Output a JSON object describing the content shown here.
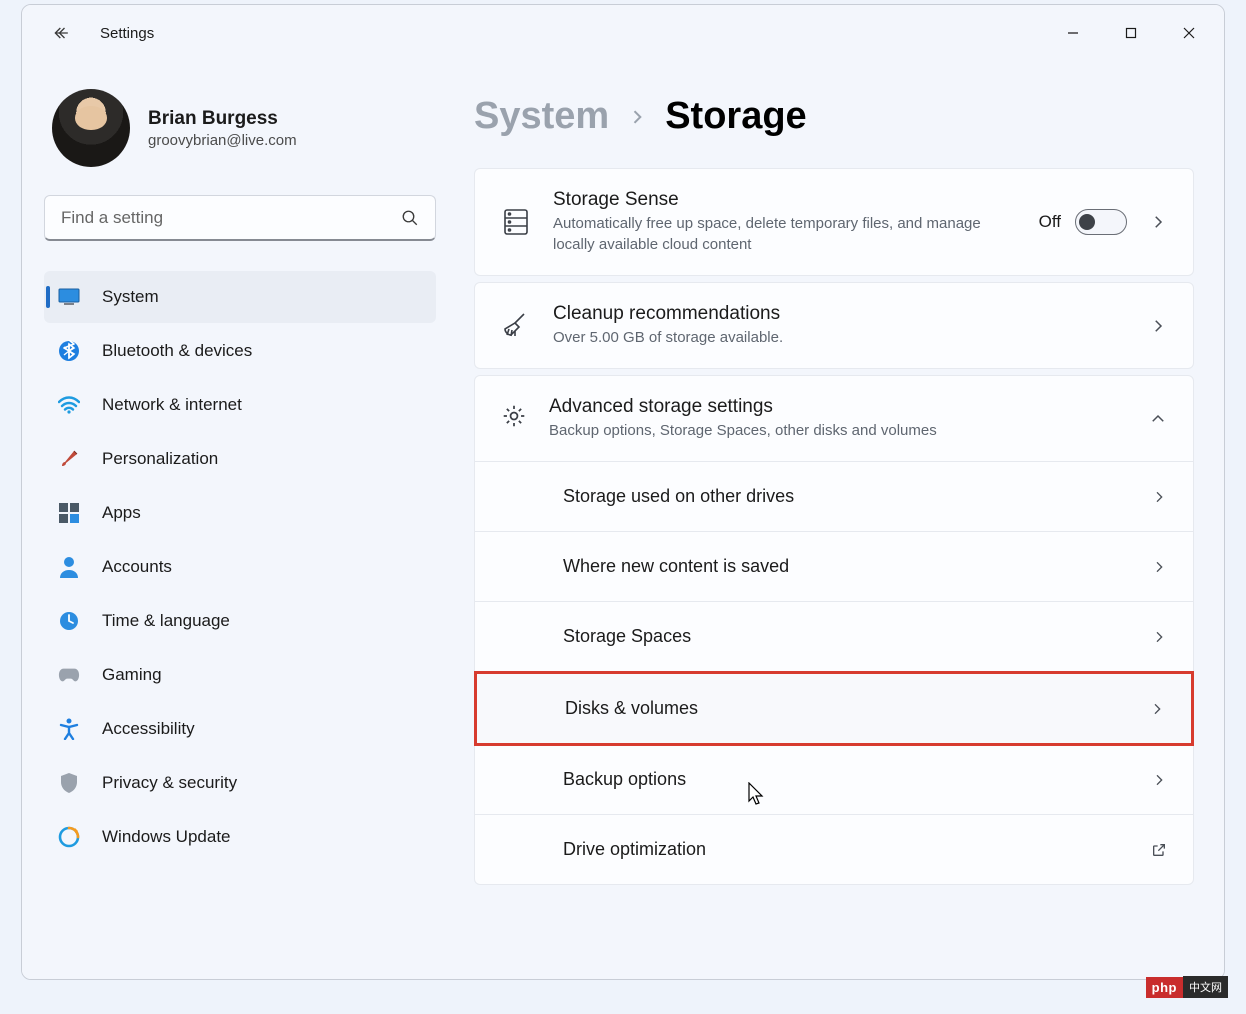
{
  "window": {
    "title": "Settings"
  },
  "profile": {
    "name": "Brian Burgess",
    "email": "groovybrian@live.com"
  },
  "search": {
    "placeholder": "Find a setting"
  },
  "nav": {
    "items": [
      {
        "label": "System",
        "active": true
      },
      {
        "label": "Bluetooth & devices"
      },
      {
        "label": "Network & internet"
      },
      {
        "label": "Personalization"
      },
      {
        "label": "Apps"
      },
      {
        "label": "Accounts"
      },
      {
        "label": "Time & language"
      },
      {
        "label": "Gaming"
      },
      {
        "label": "Accessibility"
      },
      {
        "label": "Privacy & security"
      },
      {
        "label": "Windows Update"
      }
    ]
  },
  "breadcrumb": {
    "parent": "System",
    "current": "Storage"
  },
  "storageSense": {
    "title": "Storage Sense",
    "sub": "Automatically free up space, delete temporary files, and manage locally available cloud content",
    "toggle": "Off"
  },
  "cleanup": {
    "title": "Cleanup recommendations",
    "sub": "Over 5.00 GB of storage available."
  },
  "advanced": {
    "title": "Advanced storage settings",
    "sub": "Backup options, Storage Spaces, other disks and volumes",
    "items": [
      "Storage used on other drives",
      "Where new content is saved",
      "Storage Spaces",
      "Disks & volumes",
      "Backup options",
      "Drive optimization"
    ]
  },
  "footer_badge": {
    "left": "php",
    "right": "中文网"
  }
}
